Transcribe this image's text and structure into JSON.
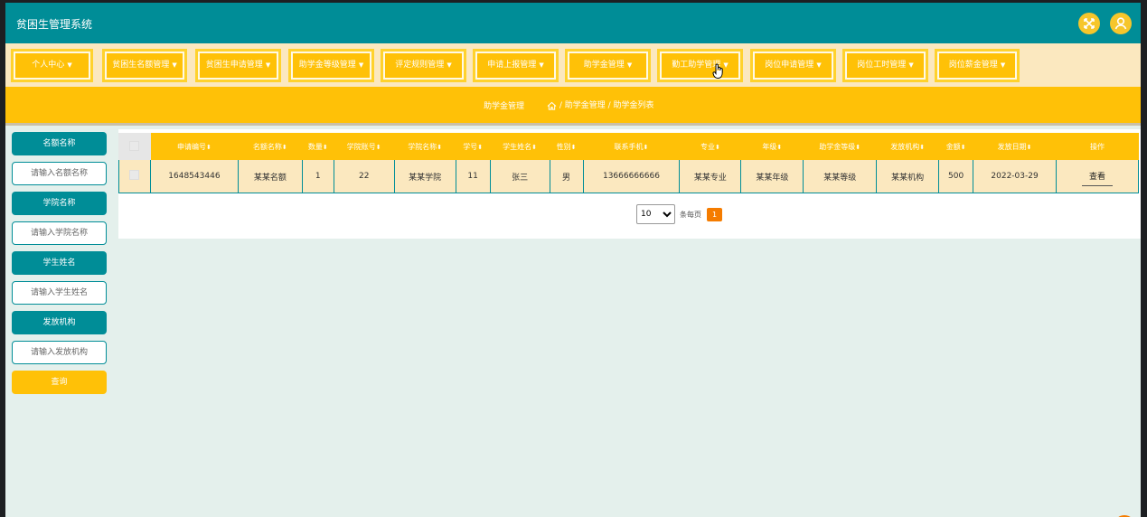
{
  "app": {
    "title": "贫困生管理系统"
  },
  "topbar": {
    "icons": [
      "fullscreen-icon",
      "user-icon"
    ],
    "accent": "#008d97",
    "icon_color": "#f6c62b"
  },
  "menu": [
    {
      "label": "个人中心"
    },
    {
      "label": "贫困生名额管理"
    },
    {
      "label": "贫困生申请管理"
    },
    {
      "label": "助学金等级管理"
    },
    {
      "label": "评定规则管理"
    },
    {
      "label": "申请上报管理"
    },
    {
      "label": "助学金管理"
    },
    {
      "label": "勤工助学管理"
    },
    {
      "label": "岗位申请管理"
    },
    {
      "label": "岗位工时管理"
    },
    {
      "label": "岗位薪金管理"
    }
  ],
  "breadcrumb": {
    "section": "助学金管理",
    "path": "/ 助学金管理 / 助学金列表"
  },
  "search": {
    "fields": [
      {
        "label": "名额名称",
        "placeholder": "请输入名额名称"
      },
      {
        "label": "学院名称",
        "placeholder": "请输入学院名称"
      },
      {
        "label": "学生姓名",
        "placeholder": "请输入学生姓名"
      },
      {
        "label": "发放机构",
        "placeholder": "请输入发放机构"
      }
    ],
    "button": "查询"
  },
  "table": {
    "headers": [
      "申请编号",
      "名额名称",
      "数量",
      "学院账号",
      "学院名称",
      "学号",
      "学生姓名",
      "性别",
      "联系手机",
      "专业",
      "年级",
      "助学金等级",
      "发放机构",
      "金额",
      "发放日期",
      "操作"
    ],
    "rows": [
      {
        "cells": [
          "1648543446",
          "某某名额",
          "1",
          "22",
          "某某学院",
          "11",
          "张三",
          "男",
          "13666666666",
          "某某专业",
          "某某年级",
          "某某等级",
          "某某机构",
          "500",
          "2022-03-29"
        ],
        "action": "查看"
      }
    ]
  },
  "pagination": {
    "page_size": "10",
    "per_page_label": "条每页",
    "current_page": "1"
  },
  "colors": {
    "primary": "#008d97",
    "accent": "#ffc107",
    "row_bg": "#fbe8bf",
    "page_active": "#f57c00"
  }
}
